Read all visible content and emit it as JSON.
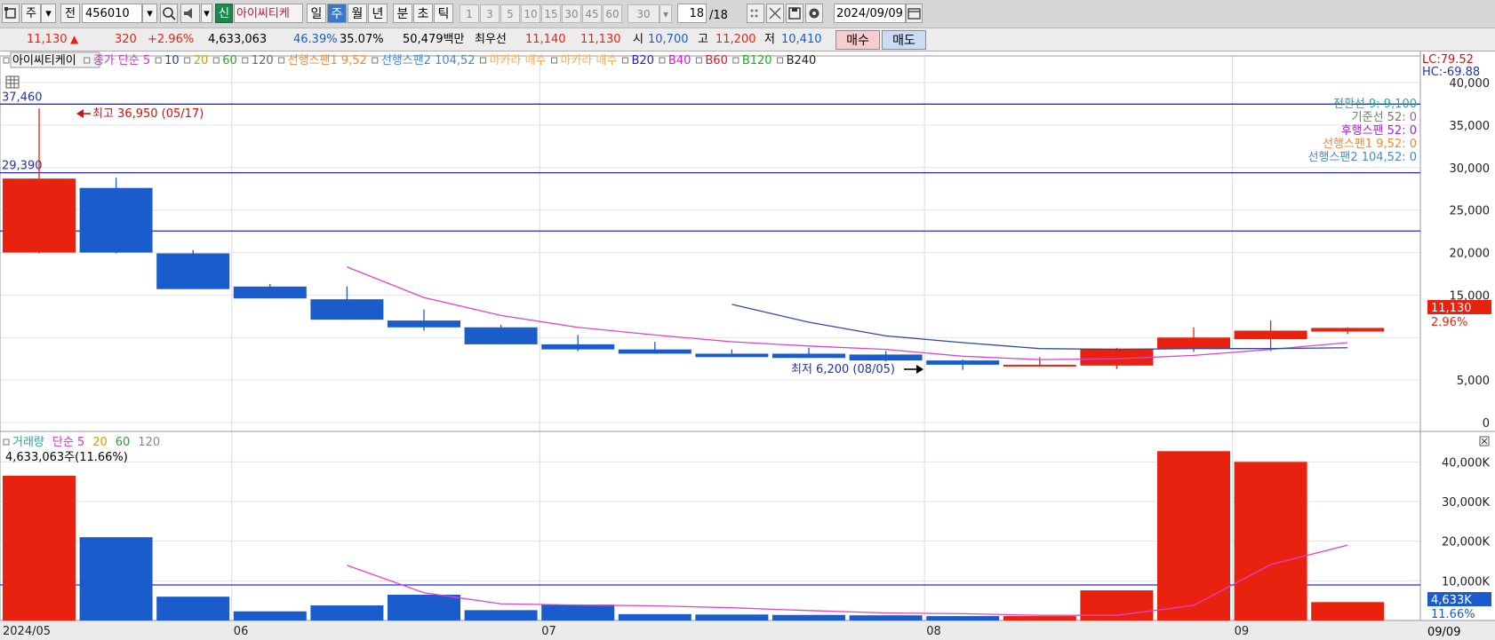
{
  "toolbar": {
    "market": "주",
    "prefix": "전",
    "code": "456010",
    "badge_new": "신",
    "stock_name": "아이씨티케",
    "periods": [
      "일",
      "주",
      "월",
      "년",
      "분",
      "초",
      "틱"
    ],
    "selected_period": "주",
    "minute_options": [
      "1",
      "3",
      "5",
      "10",
      "15",
      "30",
      "45",
      "60"
    ],
    "custom_value": "30",
    "page_counter": "18",
    "page_total": "/18",
    "date": "2024/09/09"
  },
  "quote": {
    "price": "11,130",
    "change_arrow": "▲",
    "change": "320",
    "change_pct": "+2.96%",
    "volume": "4,633,063",
    "ratio1": "46.39%",
    "ratio2": "35.07%",
    "amount": "50,479백만",
    "best_label": "최우선",
    "best_ask": "11,140",
    "best_bid": "11,130",
    "open_label": "시",
    "open": "10,700",
    "high_label": "고",
    "high": "11,200",
    "low_label": "저",
    "low": "10,410",
    "buy_label": "매수",
    "sell_label": "매도"
  },
  "colors": {
    "up": "#e8220f",
    "down": "#1a5ccc",
    "ma5": "#dd44cc",
    "ma10": "#2d4aa0",
    "hline": "#2a2ad0"
  },
  "price_legend": [
    {
      "text": "아이씨티케이",
      "color": "#000000",
      "boxed": true
    },
    {
      "text": "종가 단순 5",
      "color": "#cc33cc"
    },
    {
      "text": "10",
      "color": "#2244aa"
    },
    {
      "text": "20",
      "color": "#dd9900"
    },
    {
      "text": "60",
      "color": "#339933"
    },
    {
      "text": "120",
      "color": "#666666"
    },
    {
      "text": "선행스팬1 9,52",
      "color": "#ee8833"
    },
    {
      "text": "선행스팬2 104,52",
      "color": "#4488cc"
    },
    {
      "text": "마카라 매수",
      "color": "#ffaa55"
    },
    {
      "text": "마카라 매수",
      "color": "#ffaa55"
    },
    {
      "text": "B20",
      "color": "#2222cc"
    },
    {
      "text": "B40",
      "color": "#cc22cc"
    },
    {
      "text": "B60",
      "color": "#cc2222"
    },
    {
      "text": "B120",
      "color": "#22aa22"
    },
    {
      "text": "B240",
      "color": "#222222"
    }
  ],
  "ichimoku_labels": [
    {
      "text": "전환선 9: 9,100",
      "color": "#22aa99"
    },
    {
      "text": "기준선 52: 0",
      "color": "#777777"
    },
    {
      "text": "후행스팬 52: 0",
      "color": "#aa22cc"
    },
    {
      "text": "선행스팬1 9,52: 0",
      "color": "#ee8833"
    },
    {
      "text": "선행스팬2 104,52: 0",
      "color": "#4488cc"
    }
  ],
  "corner_labels": {
    "lc": "LC:79.52",
    "hc": "HC:-69.88"
  },
  "price_annotations": {
    "max_label": "최고 36,950 (05/17)",
    "min_label": "최저 6,200 (08/05)",
    "current_price": "11,130",
    "current_pct": "2.96%"
  },
  "volume_legend": [
    {
      "text": "거래량",
      "color": "#22aa99"
    },
    {
      "text": "단순 5",
      "color": "#cc33cc"
    },
    {
      "text": "20",
      "color": "#dd9900"
    },
    {
      "text": "60",
      "color": "#339933"
    },
    {
      "text": "120",
      "color": "#888888"
    }
  ],
  "volume_info": "4,633,063주(11.66%)",
  "volume_current": "4,633K",
  "volume_pct": "11.66%",
  "x_labels": [
    {
      "text": "2024/05",
      "bar": 0
    },
    {
      "text": "06",
      "bar": 3
    },
    {
      "text": "07",
      "bar": 7
    },
    {
      "text": "08",
      "bar": 12
    },
    {
      "text": "09",
      "bar": 16
    }
  ],
  "x_end_label": "09/09",
  "chart_data": {
    "type": "candlestick",
    "title": "아이씨티케이",
    "ohlc": [
      {
        "open": 20000,
        "high": 36950,
        "low": 19900,
        "close": 28700
      },
      {
        "open": 27600,
        "high": 28800,
        "low": 19900,
        "close": 20000
      },
      {
        "open": 19900,
        "high": 20300,
        "low": 15700,
        "close": 15700
      },
      {
        "open": 16000,
        "high": 16300,
        "low": 14600,
        "close": 14600
      },
      {
        "open": 14500,
        "high": 16000,
        "low": 12100,
        "close": 12100
      },
      {
        "open": 12000,
        "high": 13300,
        "low": 10800,
        "close": 11200
      },
      {
        "open": 11200,
        "high": 11500,
        "low": 9200,
        "close": 9200
      },
      {
        "open": 9200,
        "high": 10300,
        "low": 8400,
        "close": 8600
      },
      {
        "open": 8600,
        "high": 9500,
        "low": 8100,
        "close": 8100
      },
      {
        "open": 8100,
        "high": 8600,
        "low": 7700,
        "close": 7700
      },
      {
        "open": 8100,
        "high": 8800,
        "low": 7600,
        "close": 7600
      },
      {
        "open": 8000,
        "high": 8400,
        "low": 7200,
        "close": 7300
      },
      {
        "open": 7300,
        "high": 7400,
        "low": 6200,
        "close": 6800
      },
      {
        "open": 6800,
        "high": 7700,
        "low": 6600,
        "close": 6800
      },
      {
        "open": 6700,
        "high": 8800,
        "low": 6300,
        "close": 8700
      },
      {
        "open": 8700,
        "high": 11200,
        "low": 8300,
        "close": 10000
      },
      {
        "open": 9800,
        "high": 12000,
        "low": 8400,
        "close": 10810
      },
      {
        "open": 10700,
        "high": 11200,
        "low": 10410,
        "close": 11130
      }
    ],
    "volume": [
      36500000,
      21000000,
      6000000,
      2300000,
      3800000,
      6500000,
      2600000,
      4000000,
      1600000,
      1500000,
      1400000,
      1300000,
      1100000,
      1100000,
      7600000,
      42700000,
      40000000,
      4633063
    ],
    "ma5_price": [
      null,
      null,
      null,
      null,
      18300,
      14700,
      12600,
      11200,
      10300,
      9500,
      9000,
      8600,
      7800,
      7400,
      7500,
      7900,
      8600,
      9400
    ],
    "ma10_price": [
      null,
      null,
      null,
      null,
      null,
      null,
      null,
      null,
      null,
      13900,
      11800,
      10200,
      9400,
      8700,
      8600,
      8700,
      8700,
      8800
    ],
    "ma5_volume": [
      null,
      null,
      null,
      null,
      13900000,
      7000000,
      4200000,
      3900000,
      3700000,
      3200000,
      2500000,
      1900000,
      1700000,
      1300000,
      1300000,
      3800000,
      14100000,
      19000000
    ],
    "price_lines": [
      {
        "label": "37,460",
        "value": 37460
      },
      {
        "label": "29,390",
        "value": 29390
      },
      {
        "label": "22,529",
        "value": 22529
      }
    ],
    "volume_line": {
      "label": "8,963K",
      "value": 8963000
    },
    "price_axis": {
      "min": 0,
      "max": 40000,
      "ticks": [
        0,
        5000,
        10000,
        15000,
        20000,
        25000,
        30000,
        35000,
        40000
      ],
      "tick_labels": [
        "0",
        "5,000",
        "",
        "15,000",
        "20,000",
        "25,000",
        "30,000",
        "35,000",
        "40,000"
      ]
    },
    "volume_axis": {
      "min": 0,
      "max": 45000000,
      "ticks": [
        10000000,
        20000000,
        30000000,
        40000000
      ],
      "tick_labels": [
        "10,000K",
        "20,000K",
        "30,000K",
        "40,000K"
      ]
    },
    "grid": true
  }
}
